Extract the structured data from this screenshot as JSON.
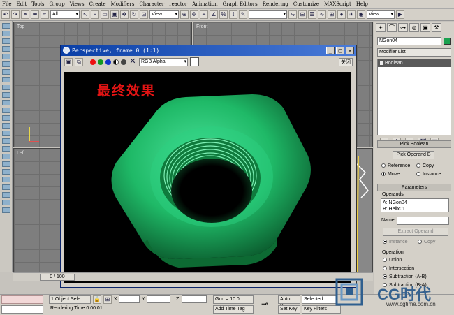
{
  "menu": [
    "File",
    "Edit",
    "Tools",
    "Group",
    "Views",
    "Create",
    "Modifiers",
    "Character",
    "reactor",
    "Animation",
    "Graph Editors",
    "Rendering",
    "Customize",
    "MAXScript",
    "Help"
  ],
  "toolbar": {
    "selection_filter": "All",
    "ref_coord": "View",
    "ref_coord_right": "View"
  },
  "viewports": {
    "top": "Top",
    "front": "Front",
    "left": "Left"
  },
  "render_window": {
    "title": "Perspective, frame 0 (1:1)",
    "channel": "RGB Alpha",
    "close_label": "关闭",
    "caption": "最终效果"
  },
  "command_panel": {
    "object_name": "NGon04",
    "object_color": "#1aa14f",
    "modifier_list": "Modifier List",
    "stack_item": "Boolean",
    "pick_boolean_title": "Pick Boolean",
    "pick_operand_button": "Pick Operand B",
    "pick_options": [
      "Reference",
      "Copy",
      "Move",
      "Instance"
    ],
    "parameters_title": "Parameters",
    "operands_label": "Operands",
    "operands": [
      "A: NGon04",
      "B: Helix01"
    ],
    "name_label": "Name:",
    "extract_button": "Extract Operand",
    "extract_options": [
      "Instance",
      "Copy"
    ],
    "operation_label": "Operation",
    "operations": [
      "Union",
      "Intersection",
      "Subtraction (A-B)",
      "Subtraction (B-A)"
    ]
  },
  "time_slider": "0 / 100",
  "status": {
    "selection": "1 Object Sele",
    "x_label": "X:",
    "y_label": "Y:",
    "z_label": "Z:",
    "grid": "Grid = 10.0",
    "auto_key": "Auto Key",
    "selected": "Selected",
    "set_key": "Set Key",
    "key_filters": "Key Filters",
    "rendering_time": "Rendering Time  0:00:01",
    "add_time_tag": "Add Time Tag"
  },
  "watermark": {
    "logo": "CG时代",
    "url": "www.cgtime.com.cn"
  }
}
